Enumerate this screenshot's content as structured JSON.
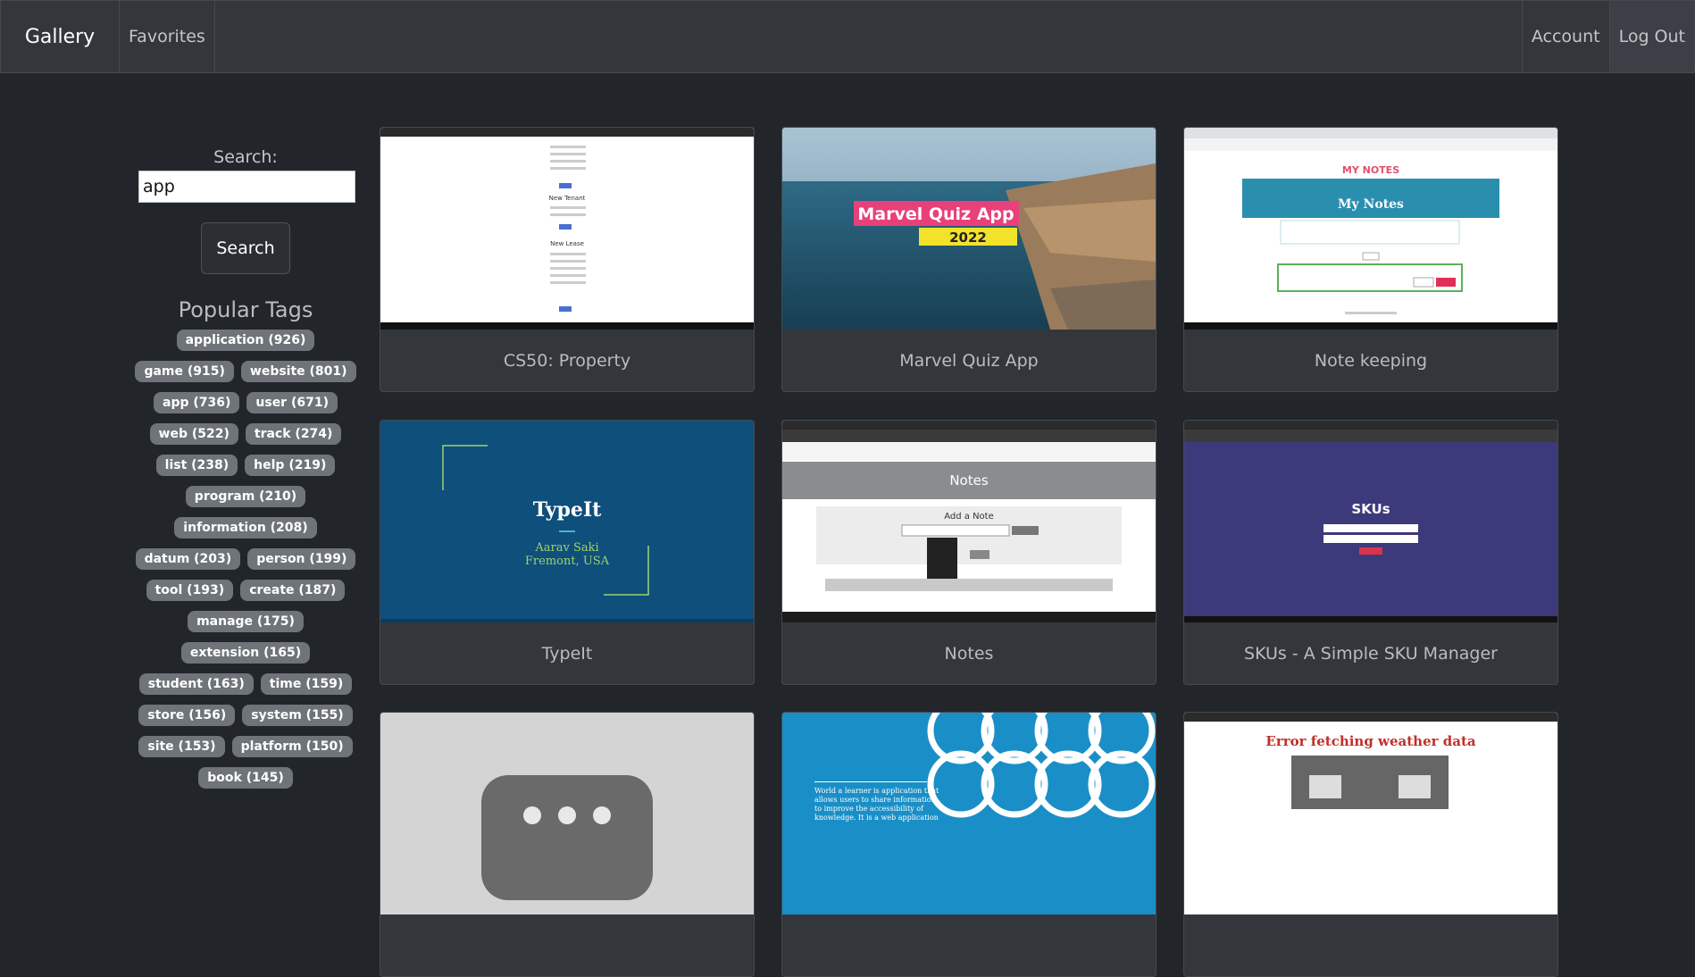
{
  "nav": {
    "brand": "Gallery",
    "favorites": "Favorites",
    "account": "Account",
    "logout": "Log Out"
  },
  "search": {
    "label": "Search:",
    "value": "app",
    "button": "Search"
  },
  "tags_title": "Popular Tags",
  "tags": [
    "application (926)",
    "game (915)",
    "website (801)",
    "app (736)",
    "user (671)",
    "web (522)",
    "track (274)",
    "list (238)",
    "help (219)",
    "program (210)",
    "information (208)",
    "datum (203)",
    "person (199)",
    "tool (193)",
    "create (187)",
    "manage (175)",
    "extension (165)",
    "student (163)",
    "time (159)",
    "store (156)",
    "system (155)",
    "site (153)",
    "platform (150)",
    "book (145)"
  ],
  "cards": [
    {
      "title": "CS50: Property",
      "thumb": {
        "label_a": "New Tenant",
        "label_b": "New Lease"
      }
    },
    {
      "title": "Marvel Quiz App",
      "thumb": {
        "line1": "Marvel Quiz App",
        "line2": "2022"
      }
    },
    {
      "title": "Note keeping",
      "thumb": {
        "header": "MY NOTES",
        "banner": "My Notes"
      }
    },
    {
      "title": "TypeIt",
      "thumb": {
        "name": "TypeIt",
        "author": "Aarav Saki",
        "place": "Fremont, USA"
      }
    },
    {
      "title": "Notes",
      "thumb": {
        "header": "Notes",
        "sub": "Add a Note"
      }
    },
    {
      "title": "SKUs - A Simple SKU Manager",
      "thumb": {
        "logo": "SKUs"
      }
    },
    {
      "title": "",
      "thumb": {}
    },
    {
      "title": "",
      "thumb": {
        "text": "World a learner is application that allows users to share information to improve the accessibility of knowledge. It is a web application"
      }
    },
    {
      "title": "",
      "thumb": {
        "header": "Error fetching weather data"
      }
    }
  ],
  "colors": {
    "background": "#222529",
    "navbar": "#33373c",
    "tag": "#6e7479",
    "card": "#33373c"
  }
}
